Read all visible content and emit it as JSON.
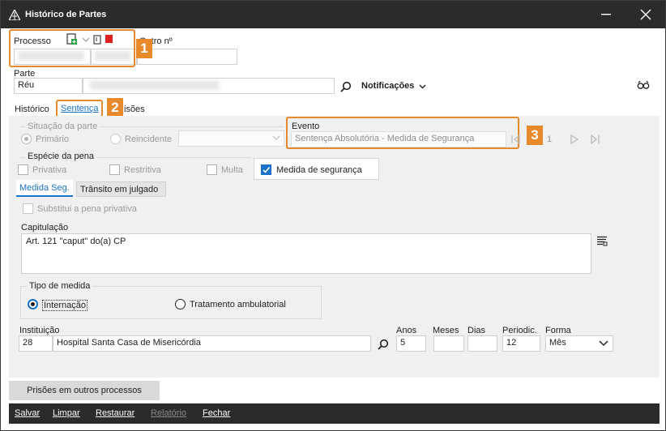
{
  "window": {
    "title": "Histórico de Partes"
  },
  "header": {
    "processo_label": "Processo",
    "outro_label": "Outro nº",
    "parte_label": "Parte",
    "parte_tipo": "Réu",
    "notificacoes_label": "Notificações"
  },
  "tabs": {
    "historico": "Histórico",
    "sentenca": "Sentença",
    "prisoes": "isões"
  },
  "situacao": {
    "legend": "Situação da parte",
    "primario": "Primário",
    "reincidente": "Reincidente",
    "selected": "Primário"
  },
  "evento": {
    "label": "Evento",
    "value": "Sentença Absolutória - Medida de Segurança",
    "counter": "1"
  },
  "especie": {
    "legend": "Espécie da pena",
    "privativa": "Privativa",
    "restritiva": "Restritiva",
    "multa": "Multa",
    "medida": "Medida de segurança",
    "medida_checked": true
  },
  "subtabs": {
    "medida_seg": "Medida Seg.",
    "transito": "Trânsito em julgado"
  },
  "substitui": "Substitui a pena privativa",
  "capitulacao": {
    "label": "Capitulação",
    "value": "Art. 121 \"caput\" do(a) CP"
  },
  "tipo_medida": {
    "legend": "Tipo de medida",
    "internacao": "Internação",
    "tratamento": "Tratamento ambulatorial",
    "selected": "Internação"
  },
  "instituicao": {
    "label": "Instituição",
    "code": "28",
    "name": "Hospital Santa Casa de Misericórdia"
  },
  "prazo": {
    "anos_label": "Anos",
    "anos": "5",
    "meses_label": "Meses",
    "meses": "",
    "dias_label": "Dias",
    "dias": "",
    "periodic_label": "Periodic.",
    "periodic": "12",
    "forma_label": "Forma",
    "forma": "Mês"
  },
  "prisoes_outros": "Prisões em outros processos",
  "footer": {
    "salvar": "Salvar",
    "limpar": "Limpar",
    "restaurar": "Restaurar",
    "relatorio": "Relatório",
    "fechar": "Fechar"
  },
  "callouts": [
    "1",
    "2",
    "3"
  ],
  "colors": {
    "titlebar": "#2b2b2b",
    "accent": "#1a73c8",
    "callout": "#e8892b"
  }
}
